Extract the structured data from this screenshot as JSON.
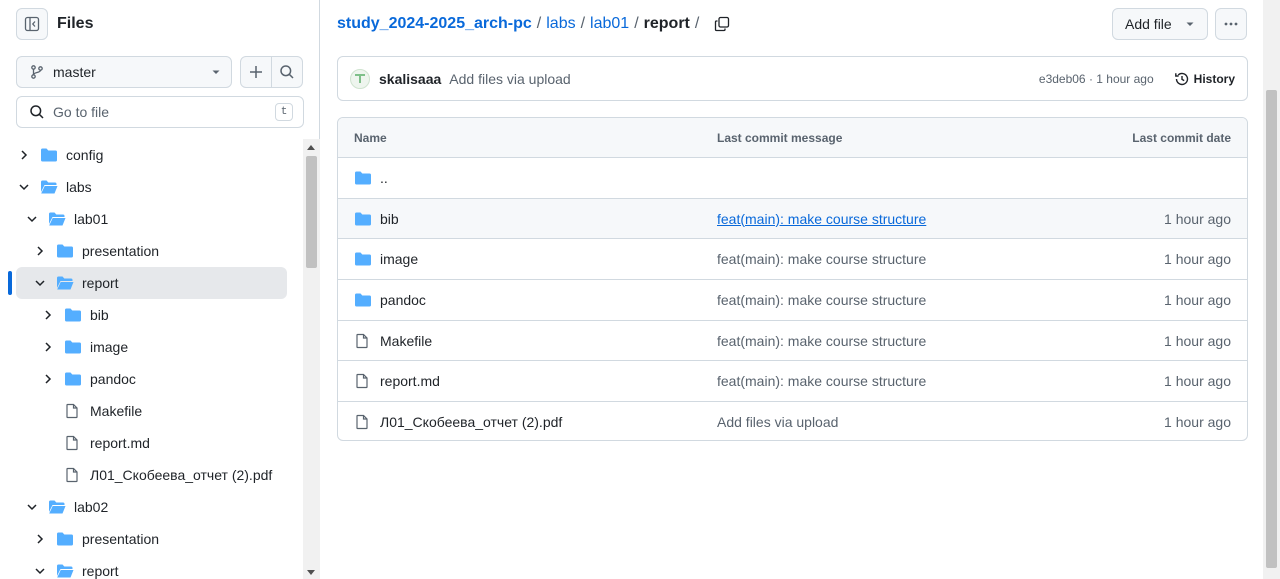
{
  "sidebar": {
    "title": "Files",
    "branch": "master",
    "search_placeholder": "Go to file",
    "search_shortcut": "t",
    "tree": [
      {
        "label": "config",
        "type": "folder",
        "level": 0,
        "expanded": false
      },
      {
        "label": "labs",
        "type": "folder",
        "level": 0,
        "expanded": true
      },
      {
        "label": "lab01",
        "type": "folder",
        "level": 1,
        "expanded": true
      },
      {
        "label": "presentation",
        "type": "folder",
        "level": 2,
        "expanded": false
      },
      {
        "label": "report",
        "type": "folder",
        "level": 2,
        "expanded": true,
        "selected": true
      },
      {
        "label": "bib",
        "type": "folder",
        "level": 3,
        "expanded": false
      },
      {
        "label": "image",
        "type": "folder",
        "level": 3,
        "expanded": false
      },
      {
        "label": "pandoc",
        "type": "folder",
        "level": 3,
        "expanded": false
      },
      {
        "label": "Makefile",
        "type": "file",
        "level": 3
      },
      {
        "label": "report.md",
        "type": "file",
        "level": 3
      },
      {
        "label": "Л01_Скобеева_отчет (2).pdf",
        "type": "file",
        "level": 3
      },
      {
        "label": "lab02",
        "type": "folder",
        "level": 1,
        "expanded": true
      },
      {
        "label": "presentation",
        "type": "folder",
        "level": 2,
        "expanded": false
      },
      {
        "label": "report",
        "type": "folder",
        "level": 2,
        "expanded": true
      }
    ]
  },
  "breadcrumb": {
    "repo": "study_2024-2025_arch-pc",
    "parts": [
      "labs",
      "lab01"
    ],
    "current": "report",
    "separator": "/"
  },
  "header": {
    "add_file_label": "Add file"
  },
  "commit": {
    "author": "skalisaaa",
    "message": "Add files via upload",
    "meta": "e3deb06 · 1 hour ago",
    "history_label": "History"
  },
  "files": {
    "headers": {
      "name": "Name",
      "message": "Last commit message",
      "date": "Last commit date"
    },
    "rows": [
      {
        "name": "..",
        "type": "folder",
        "message": "",
        "date": ""
      },
      {
        "name": "bib",
        "type": "folder",
        "message": "feat(main): make course structure",
        "date": "1 hour ago"
      },
      {
        "name": "image",
        "type": "folder",
        "message": "feat(main): make course structure",
        "date": "1 hour ago"
      },
      {
        "name": "pandoc",
        "type": "folder",
        "message": "feat(main): make course structure",
        "date": "1 hour ago"
      },
      {
        "name": "Makefile",
        "type": "file",
        "message": "feat(main): make course structure",
        "date": "1 hour ago"
      },
      {
        "name": "report.md",
        "type": "file",
        "message": "feat(main): make course structure",
        "date": "1 hour ago"
      },
      {
        "name": "Л01_Скобеева_отчет (2).pdf",
        "type": "file",
        "message": "Add files via upload",
        "date": "1 hour ago"
      }
    ]
  },
  "colors": {
    "accent": "#0969da",
    "folder": "#54aeff",
    "muted": "#59636e",
    "border": "#d1d9e0"
  }
}
